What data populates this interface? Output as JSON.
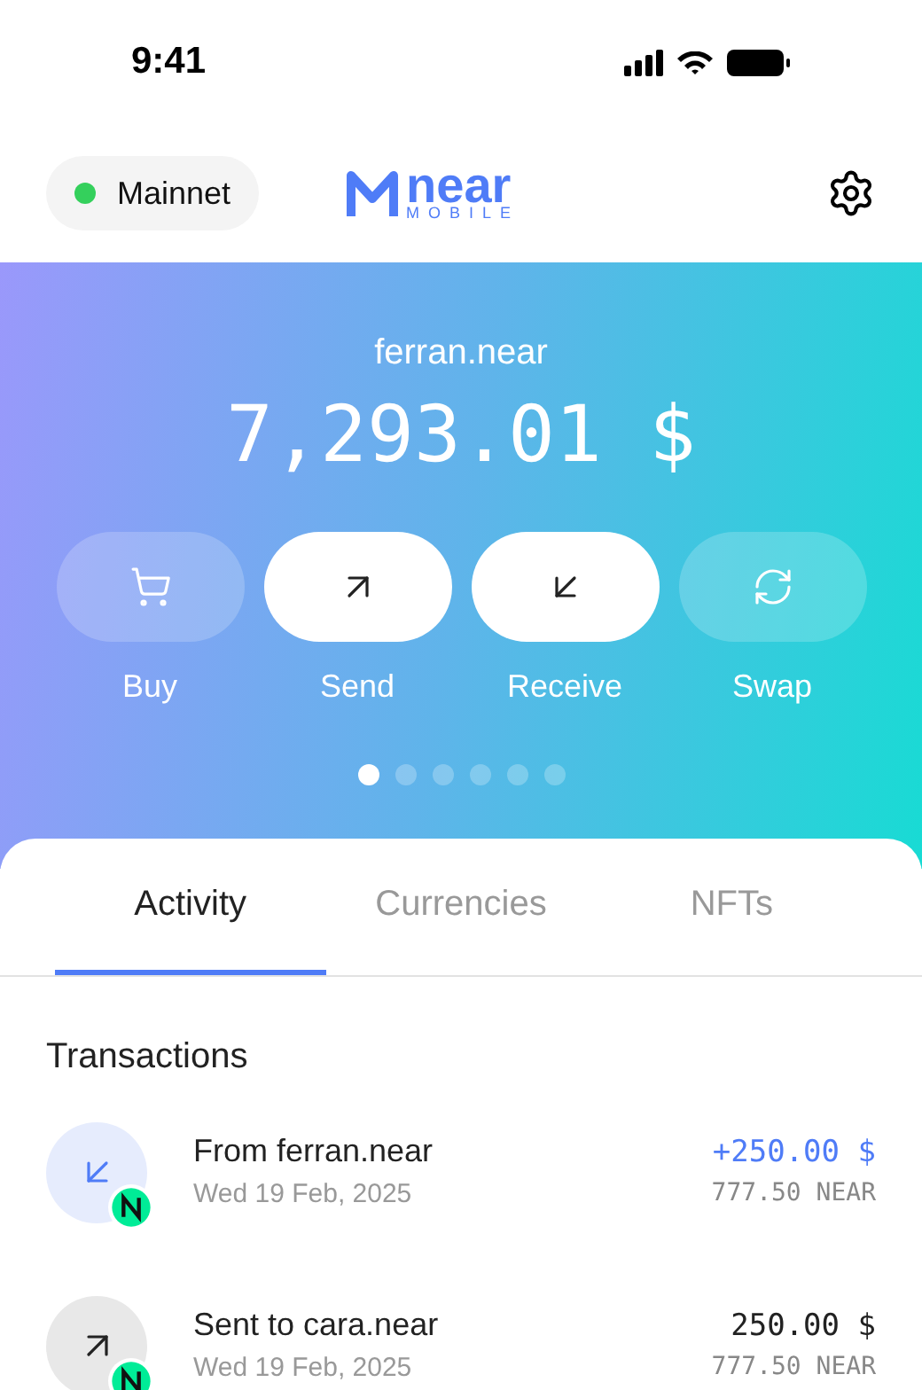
{
  "status_bar": {
    "time": "9:41"
  },
  "header": {
    "network": {
      "label": "Mainnet",
      "color": "#34d05c"
    },
    "logo": {
      "word": "near",
      "sub": "MOBILE"
    }
  },
  "balance": {
    "account": "ferran.near",
    "amount": "7,293.01 $"
  },
  "actions": [
    {
      "label": "Buy",
      "kind": "buy",
      "highlighted": false
    },
    {
      "label": "Send",
      "kind": "send",
      "highlighted": true
    },
    {
      "label": "Receive",
      "kind": "receive",
      "highlighted": true
    },
    {
      "label": "Swap",
      "kind": "swap",
      "highlighted": false
    }
  ],
  "pager": [
    {
      "selected": true
    },
    {
      "selected": false
    },
    {
      "selected": false
    },
    {
      "selected": false
    },
    {
      "selected": false
    },
    {
      "selected": false
    }
  ],
  "tabs": [
    {
      "label": "Activity",
      "selected": true
    },
    {
      "label": "Currencies",
      "selected": false
    },
    {
      "label": "NFTs",
      "selected": false
    }
  ],
  "transactions": {
    "title": "Transactions",
    "items": [
      {
        "kind": "incoming",
        "title": "From ferran.near",
        "date": "Wed 19 Feb, 2025",
        "amount": "+250.00 $",
        "tokens": "777.50 NEAR"
      },
      {
        "kind": "outgoing",
        "title": "Sent to cara.near",
        "date": "Wed 19 Feb, 2025",
        "amount": "250.00 $",
        "tokens": "777.50 NEAR"
      }
    ]
  }
}
